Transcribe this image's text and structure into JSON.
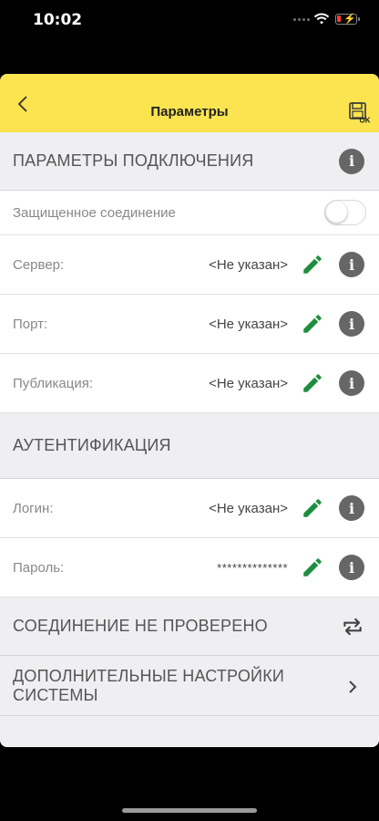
{
  "status_bar": {
    "time": "10:02"
  },
  "header": {
    "title": "Параметры"
  },
  "sections": {
    "connection": {
      "title": "ПАРАМЕТРЫ ПОДКЛЮЧЕНИЯ"
    },
    "auth": {
      "title": "АУТЕНТИФИКАЦИЯ"
    },
    "check": {
      "title": "СОЕДИНЕНИЕ НЕ ПРОВЕРЕНО"
    },
    "advanced": {
      "title_line1": "ДОПОЛНИТЕЛЬНЫЕ НАСТРОЙКИ",
      "title_line2": "СИСТЕМЫ"
    }
  },
  "rows": {
    "secure": {
      "label": "Защищенное соединение",
      "enabled": false
    },
    "server": {
      "label": "Сервер:",
      "value": "<Не указан>"
    },
    "port": {
      "label": "Порт:",
      "value": "<Не указан>"
    },
    "publication": {
      "label": "Публикация:",
      "value": "<Не указан>"
    },
    "login": {
      "label": "Логин:",
      "value": "<Не указан>"
    },
    "password": {
      "label": "Пароль:",
      "value": "**************"
    }
  },
  "icons": {
    "info": "i",
    "save_ok_badge": "OK"
  },
  "colors": {
    "header_bg": "#fbe44f",
    "edit_green": "#1e8e3e",
    "info_gray": "#666666",
    "section_bg": "#efeff2"
  }
}
